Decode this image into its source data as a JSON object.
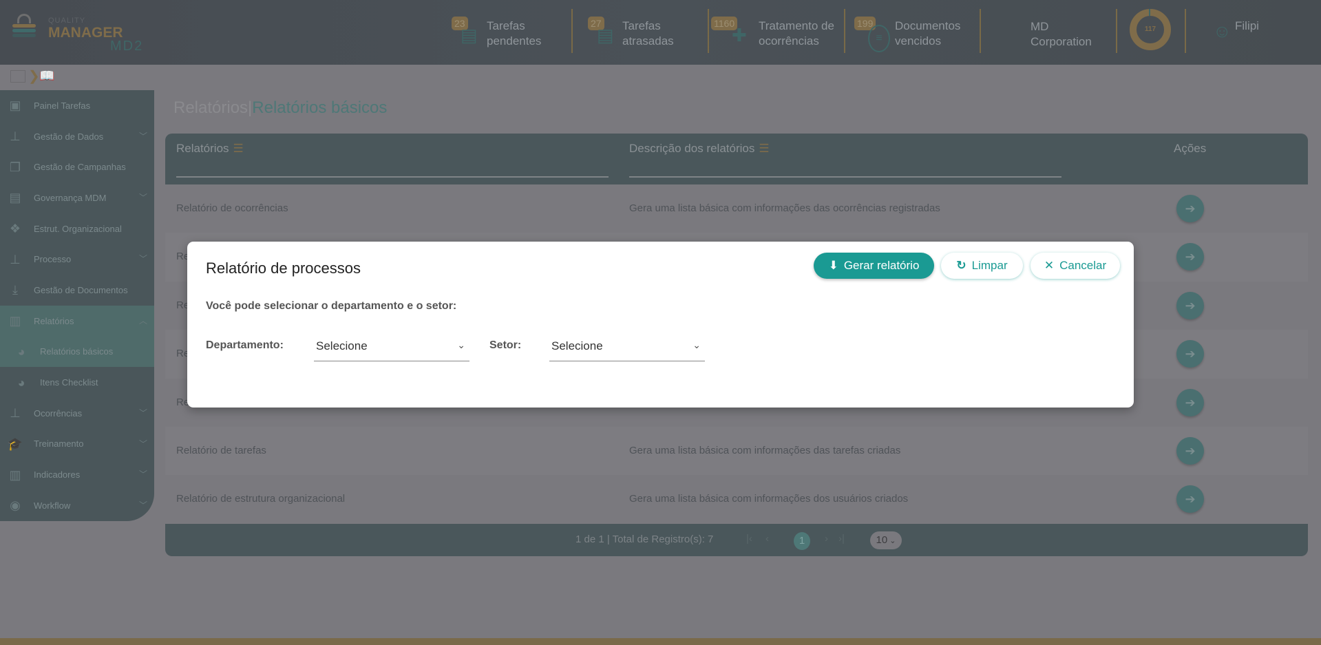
{
  "header": {
    "logo": {
      "line1": "QUALITY",
      "line2": "MANAGER",
      "line3": "MD2"
    },
    "stats": [
      {
        "count": "23",
        "line1": "Tarefas",
        "line2": "pendentes",
        "icon": "server-shield-icon"
      },
      {
        "count": "27",
        "line1": "Tarefas",
        "line2": "atrasadas",
        "icon": "server-shield-icon"
      },
      {
        "count": "1160",
        "line1": "Tratamento de",
        "line2": "ocorrências",
        "icon": "hand-plus-icon"
      },
      {
        "count": "199",
        "line1": "Documentos",
        "line2": "vencidos",
        "icon": "sliders-icon"
      }
    ],
    "company": {
      "line1": "MD",
      "line2": "Corporation"
    },
    "donut_value": "117",
    "user": "Filipi"
  },
  "sidebar": {
    "items": [
      {
        "label": "Painel Tarefas",
        "icon": "user-board-icon",
        "chevron": ""
      },
      {
        "label": "Gestão de Dados",
        "icon": "sitemap-icon",
        "chevron": "down"
      },
      {
        "label": "Gestão de Campanhas",
        "icon": "copy-icon",
        "chevron": ""
      },
      {
        "label": "Governança MDM",
        "icon": "list-icon",
        "chevron": "down"
      },
      {
        "label": "Estrut. Organizacional",
        "icon": "cubes-icon",
        "chevron": ""
      },
      {
        "label": "Processo",
        "icon": "sitemap-icon",
        "chevron": "down"
      },
      {
        "label": "Gestão de Documentos",
        "icon": "download-icon",
        "chevron": ""
      },
      {
        "label": "Relatórios",
        "icon": "bar-chart-icon",
        "chevron": "up",
        "active": true
      },
      {
        "label": "Relatórios básicos",
        "icon": "pie-chart-icon",
        "chevron": "",
        "sub": true,
        "active": true
      },
      {
        "label": "Itens Checklist",
        "icon": "pie-chart-icon",
        "chevron": "",
        "sub": true
      },
      {
        "label": "Ocorrências",
        "icon": "sitemap-icon",
        "chevron": "down"
      },
      {
        "label": "Treinamento",
        "icon": "graduation-cap-icon",
        "chevron": "down"
      },
      {
        "label": "Indicadores",
        "icon": "bar-chart-icon",
        "chevron": "down"
      },
      {
        "label": "Workflow",
        "icon": "circle-dot-icon",
        "chevron": "down"
      }
    ]
  },
  "breadcrumb": {
    "parent": "Relatórios",
    "separator": "|",
    "current": "Relatórios básicos"
  },
  "table": {
    "columns": [
      "Relatórios",
      "Descrição dos relatórios",
      "Ações"
    ],
    "rows": [
      {
        "name": "Relatório de ocorrências",
        "description": "Gera uma lista básica com informações das ocorrências registradas"
      },
      {
        "name": "Re",
        "description": ""
      },
      {
        "name": "Re",
        "description": ""
      },
      {
        "name": "Re",
        "description": ""
      },
      {
        "name": "Re",
        "description": ""
      },
      {
        "name": "Relatório de tarefas",
        "description": "Gera uma lista básica com informações das tarefas criadas"
      },
      {
        "name": "Relatório de estrutura organizacional",
        "description": "Gera uma lista básica com informações dos usuários criados"
      }
    ],
    "footer": {
      "summary": "1 de 1 | Total de Registro(s): 7",
      "current_page": "1",
      "page_size": "10"
    }
  },
  "modal": {
    "title": "Relatório de processos",
    "buttons": {
      "generate": "Gerar relatório",
      "clear": "Limpar",
      "cancel": "Cancelar"
    },
    "instruction": "Você pode selecionar o departamento e o setor:",
    "department_label": "Departamento:",
    "department_value": "Selecione",
    "sector_label": "Setor:",
    "sector_value": "Selecione"
  },
  "colors": {
    "accent": "#1a9a93",
    "gold": "#b8965a"
  }
}
